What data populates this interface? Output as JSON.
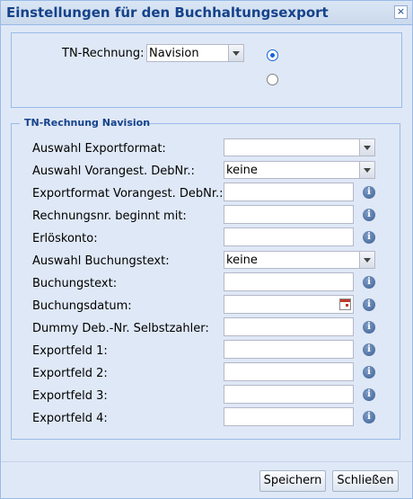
{
  "window": {
    "title": "Einstellungen für den Buchhaltungsexport",
    "close_label": "×"
  },
  "top": {
    "tn_label": "TN-Rechnung:",
    "tn_value": "Navision",
    "radio1_checked": true,
    "radio2_checked": false
  },
  "section": {
    "legend": "TN-Rechnung Navision",
    "fields": [
      {
        "label": "Auswahl Exportformat:",
        "type": "select",
        "value": ""
      },
      {
        "label": "Auswahl Vorangest. DebNr.:",
        "type": "select",
        "value": "keine"
      },
      {
        "label": "Exportformat Vorangest. DebNr.:",
        "type": "text",
        "value": "",
        "info": true
      },
      {
        "label": "Rechnungsnr. beginnt mit:",
        "type": "text",
        "value": "",
        "info": true
      },
      {
        "label": "Erlöskonto:",
        "type": "text",
        "value": "",
        "info": true
      },
      {
        "label": "Auswahl Buchungstext:",
        "type": "select",
        "value": "keine"
      },
      {
        "label": "Buchungstext:",
        "type": "text",
        "value": "",
        "info": true
      },
      {
        "label": "Buchungsdatum:",
        "type": "date",
        "value": "",
        "info": true
      },
      {
        "label": "Dummy Deb.-Nr. Selbstzahler:",
        "type": "text",
        "value": "",
        "info": true
      },
      {
        "label": "Exportfeld 1:",
        "type": "text",
        "value": "",
        "info": true
      },
      {
        "label": "Exportfeld 2:",
        "type": "text",
        "value": "",
        "info": true
      },
      {
        "label": "Exportfeld 3:",
        "type": "text",
        "value": "",
        "info": true
      },
      {
        "label": "Exportfeld 4:",
        "type": "text",
        "value": "",
        "info": true
      }
    ],
    "info_glyph": "i"
  },
  "footer": {
    "save_label": "Speichern",
    "close_label": "Schließen"
  }
}
